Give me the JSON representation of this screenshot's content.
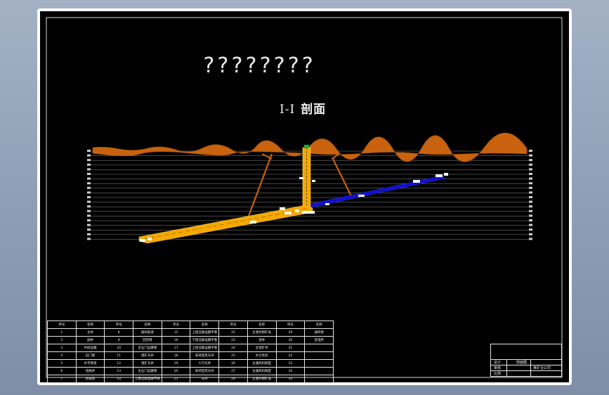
{
  "drawing": {
    "title": "????????",
    "section_label": "I-I",
    "section_name": "剖面"
  },
  "colors": {
    "background": "#000000",
    "surface": "#c8620e",
    "main_incline": "#f5a800",
    "shaft": "#f5a800",
    "blue_drift": "#1010d0",
    "brown_holes": "#c8620e",
    "grid": "#8a8a8a"
  },
  "legend": {
    "header": [
      "序号",
      "名称",
      "序号",
      "名称",
      "序号",
      "名称",
      "序号",
      "名称",
      "序号",
      "名称",
      "序号",
      "名称"
    ],
    "rows": [
      [
        "1",
        "主井",
        "8",
        "副斜坡道",
        "15",
        "上盘沿脉运输平巷",
        "22",
        "主溜井卸矿站",
        "29",
        "通风巷"
      ],
      [
        "2",
        "副井",
        "9",
        "回风巷",
        "16",
        "下盘沿脉运输平巷",
        "23",
        "溜井",
        "30",
        "变电所"
      ],
      [
        "3",
        "中段运输",
        "10",
        "主石门运输巷",
        "17",
        "上盘沿脉运输平巷",
        "24",
        "主溜矿井",
        "31",
        ""
      ],
      [
        "4",
        "石门巷",
        "11",
        "溜矿天井",
        "18",
        "采场回风天井",
        "25",
        "水仓泵房",
        "32",
        ""
      ],
      [
        "5",
        "水平巷道",
        "12",
        "溜矿天井",
        "19",
        "人行天井",
        "26",
        "主通风机硐室",
        "33",
        ""
      ],
      [
        "6",
        "措施井",
        "13",
        "主石门运输巷",
        "20",
        "采场回风天井",
        "27",
        "主通风机硐室",
        "34",
        ""
      ],
      [
        "7",
        "斜坡道",
        "14",
        "上盘沿脉运输平巷",
        "21",
        "天井",
        "28",
        "主溜井卸矿站",
        "35",
        ""
      ]
    ]
  },
  "title_block": {
    "drawing_name": "剖面图",
    "company_label": "某矿业公司",
    "designer": "设计",
    "checker": "审核",
    "scale": "比例"
  }
}
